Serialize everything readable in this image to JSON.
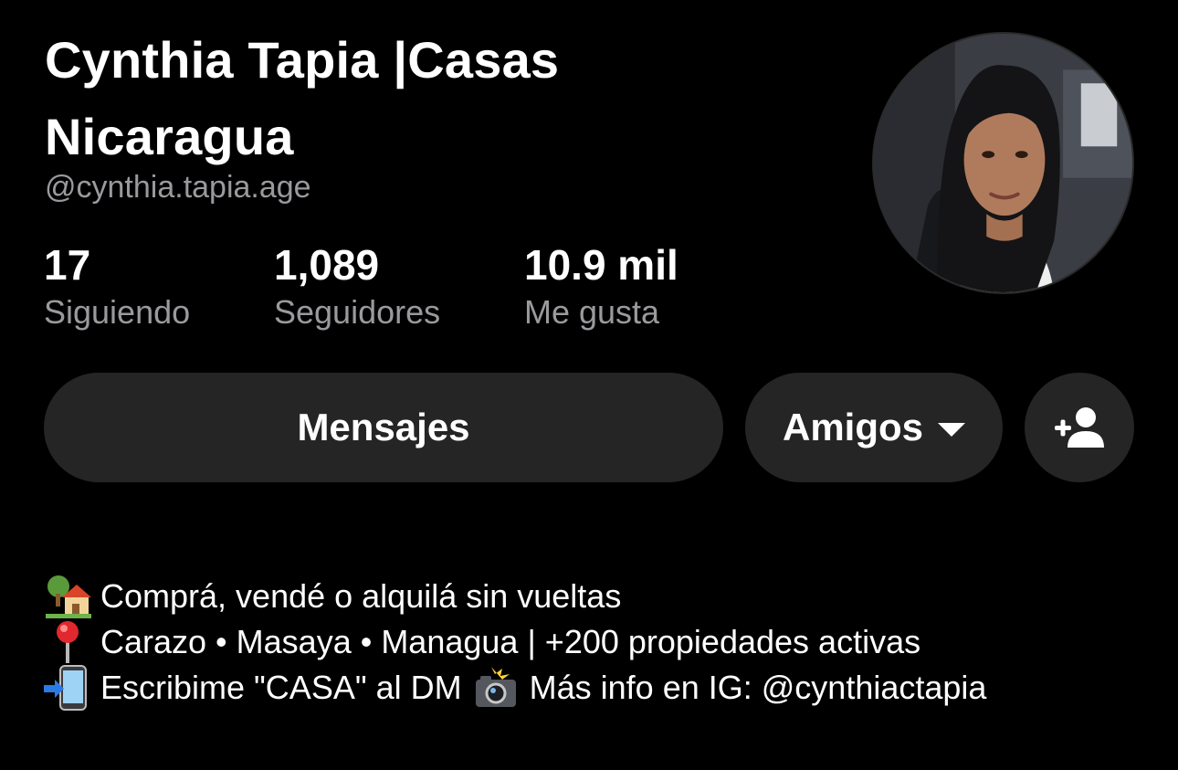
{
  "profile": {
    "display_name": "Cynthia Tapia |Casas Nicaragua",
    "username": "@cynthia.tapia.age",
    "avatar_icon": "profile-photo"
  },
  "stats": [
    {
      "value": "17",
      "label": "Siguiendo"
    },
    {
      "value": "1,089",
      "label": "Seguidores"
    },
    {
      "value": "10.9 mil",
      "label": "Me gusta"
    }
  ],
  "actions": {
    "messages_label": "Mensajes",
    "friends_label": "Amigos",
    "friends_icon": "caret-down-icon",
    "add_friend_icon": "add-person-icon"
  },
  "bio": {
    "line1": {
      "emoji": "house-with-garden",
      "text": "Comprá, vendé o alquilá sin vueltas"
    },
    "line2": {
      "emoji": "round-pushpin",
      "text": "Carazo • Masaya • Managua | +200 propiedades activas"
    },
    "line3": {
      "emoji": "mobile-phone-with-arrow",
      "text_before": "Escribime \"CASA\" al DM",
      "inline_emoji": "camera-with-flash",
      "text_after": "Más info en IG: @cynthiactapia"
    }
  },
  "colors": {
    "background": "#000000",
    "text_primary": "#ffffff",
    "text_secondary": "#9a9a9e",
    "button_bg": "#252525"
  }
}
